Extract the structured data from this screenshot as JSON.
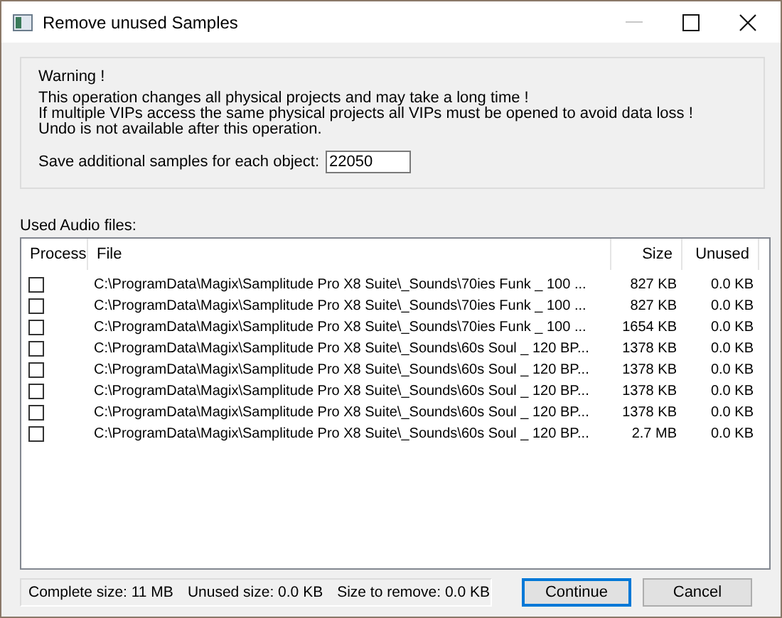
{
  "window": {
    "title": "Remove unused Samples"
  },
  "warning": {
    "heading": "Warning !",
    "lines": [
      "This operation changes all physical projects and may take a long time !",
      "If multiple VIPs access the same physical projects all VIPs must be opened to avoid data loss !",
      "Undo is not available after this operation."
    ],
    "samples_label": "Save additional samples for each object:",
    "samples_value": "22050"
  },
  "list": {
    "label": "Used Audio files:",
    "columns": [
      "Process",
      "File",
      "Size",
      "Unused"
    ],
    "rows": [
      {
        "checked": false,
        "file": "C:\\ProgramData\\Magix\\Samplitude Pro X8 Suite\\_Sounds\\70ies Funk _ 100 ...",
        "size": "827 KB",
        "unused": "0.0 KB"
      },
      {
        "checked": false,
        "file": "C:\\ProgramData\\Magix\\Samplitude Pro X8 Suite\\_Sounds\\70ies Funk _ 100 ...",
        "size": "827 KB",
        "unused": "0.0 KB"
      },
      {
        "checked": false,
        "file": "C:\\ProgramData\\Magix\\Samplitude Pro X8 Suite\\_Sounds\\70ies Funk _ 100 ...",
        "size": "1654 KB",
        "unused": "0.0 KB"
      },
      {
        "checked": false,
        "file": "C:\\ProgramData\\Magix\\Samplitude Pro X8 Suite\\_Sounds\\60s Soul _ 120 BP...",
        "size": "1378 KB",
        "unused": "0.0 KB"
      },
      {
        "checked": false,
        "file": "C:\\ProgramData\\Magix\\Samplitude Pro X8 Suite\\_Sounds\\60s Soul _ 120 BP...",
        "size": "1378 KB",
        "unused": "0.0 KB"
      },
      {
        "checked": false,
        "file": "C:\\ProgramData\\Magix\\Samplitude Pro X8 Suite\\_Sounds\\60s Soul _ 120 BP...",
        "size": "1378 KB",
        "unused": "0.0 KB"
      },
      {
        "checked": false,
        "file": "C:\\ProgramData\\Magix\\Samplitude Pro X8 Suite\\_Sounds\\60s Soul _ 120 BP...",
        "size": "1378 KB",
        "unused": "0.0 KB"
      },
      {
        "checked": false,
        "file": "C:\\ProgramData\\Magix\\Samplitude Pro X8 Suite\\_Sounds\\60s Soul _ 120 BP...",
        "size": "2.7 MB",
        "unused": "0.0 KB"
      }
    ]
  },
  "status": [
    "Complete size: 11 MB",
    "Unused size: 0.0 KB",
    "Size to remove: 0.0 KB"
  ],
  "buttons": [
    {
      "label": "Continue",
      "default": true
    },
    {
      "label": "Cancel",
      "default": false
    }
  ]
}
